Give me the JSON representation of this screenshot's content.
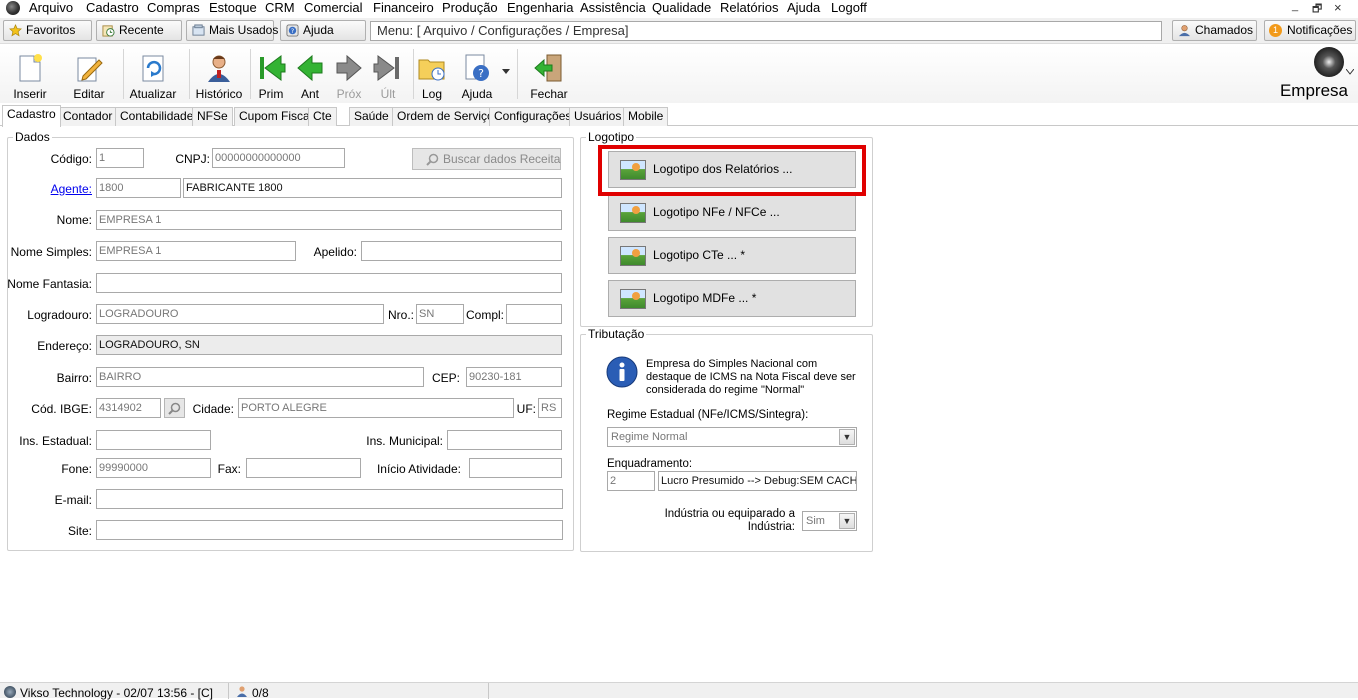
{
  "menubar": {
    "items": [
      "Arquivo",
      "Cadastro",
      "Compras",
      "Estoque",
      "CRM",
      "Comercial",
      "Financeiro",
      "Produção",
      "Engenharia",
      "Assistência",
      "Qualidade",
      "Relatórios",
      "Ajuda",
      "Logoff"
    ]
  },
  "window_controls": {
    "minimize": "_",
    "restore": "🗗",
    "close": "×"
  },
  "favbar": {
    "favoritos": "Favoritos",
    "recente": "Recente",
    "mais_usados": "Mais Usados",
    "ajuda": "Ajuda",
    "menu_path": "Menu: [ Arquivo / Configurações / Empresa]",
    "chamados": "Chamados",
    "notificacoes": "Notificações",
    "notif_count": "1"
  },
  "toolbar": {
    "inserir": "Inserir",
    "editar": "Editar",
    "atualizar": "Atualizar",
    "historico": "Histórico",
    "prim": "Prim",
    "ant": "Ant",
    "prox": "Próx",
    "ult": "Últ",
    "log": "Log",
    "ajuda": "Ajuda",
    "fechar": "Fechar",
    "empresa": "Empresa"
  },
  "tabs": [
    "Cadastro",
    "Contador",
    "Contabilidade",
    "NFSe",
    "Cupom Fiscal",
    "Cte",
    "Saúde",
    "Ordem de Serviço",
    "Configurações",
    "Usuários",
    "Mobile"
  ],
  "dados": {
    "legend": "Dados",
    "codigo_label": "Código:",
    "codigo": "1",
    "cnpj_label": "CNPJ:",
    "cnpj": "00000000000000",
    "buscar_receita": "Buscar dados Receita",
    "agente_label": "Agente:",
    "agente_code": "1800",
    "agente_name": "FABRICANTE 1800",
    "nome_label": "Nome:",
    "nome": "EMPRESA 1",
    "nome_simples_label": "Nome Simples:",
    "nome_simples": "EMPRESA 1",
    "apelido_label": "Apelido:",
    "apelido": "",
    "nome_fantasia_label": "Nome Fantasia:",
    "nome_fantasia": "",
    "logradouro_label": "Logradouro:",
    "logradouro": "LOGRADOURO",
    "nro_label": "Nro.:",
    "nro": "SN",
    "compl_label": "Compl:",
    "compl": "",
    "endereco_label": "Endereço:",
    "endereco": "LOGRADOURO, SN",
    "bairro_label": "Bairro:",
    "bairro": "BAIRRO",
    "cep_label": "CEP:",
    "cep": "90230-181",
    "cod_ibge_label": "Cód. IBGE:",
    "cod_ibge": "4314902",
    "cidade_label": "Cidade:",
    "cidade": "PORTO ALEGRE",
    "uf_label": "UF:",
    "uf": "RS",
    "ins_estadual_label": "Ins. Estadual:",
    "ins_estadual": "",
    "ins_municipal_label": "Ins. Municipal:",
    "ins_municipal": "",
    "fone_label": "Fone:",
    "fone": "99990000",
    "fax_label": "Fax:",
    "fax": "",
    "inicio_atividade_label": "Início Atividade:",
    "inicio_atividade": "",
    "email_label": "E-mail:",
    "email": "",
    "site_label": "Site:",
    "site": ""
  },
  "logotipo": {
    "legend": "Logotipo",
    "relatorios": "Logotipo dos Relatórios ...",
    "nfe": "Logotipo NFe / NFCe ...",
    "cte": "Logotipo CTe ... *",
    "mdfe": "Logotipo MDFe ... *"
  },
  "tributacao": {
    "legend": "Tributação",
    "info": "Empresa do Simples Nacional com destaque de ICMS na Nota Fiscal deve ser considerada do regime \"Normal\"",
    "regime_label": "Regime Estadual (NFe/ICMS/Sintegra):",
    "regime_value": "Regime Normal",
    "enquadramento_label": "Enquadramento:",
    "enquadramento_code": "2",
    "enquadramento_text": "Lucro Presumido   --> Debug:SEM CACHE",
    "industria_label": "Indústria ou equiparado a Indústria:",
    "industria_value": "Sim"
  },
  "statusbar": {
    "left": "Vikso Technology - 02/07 13:56 - [C]",
    "count": "0/8"
  }
}
